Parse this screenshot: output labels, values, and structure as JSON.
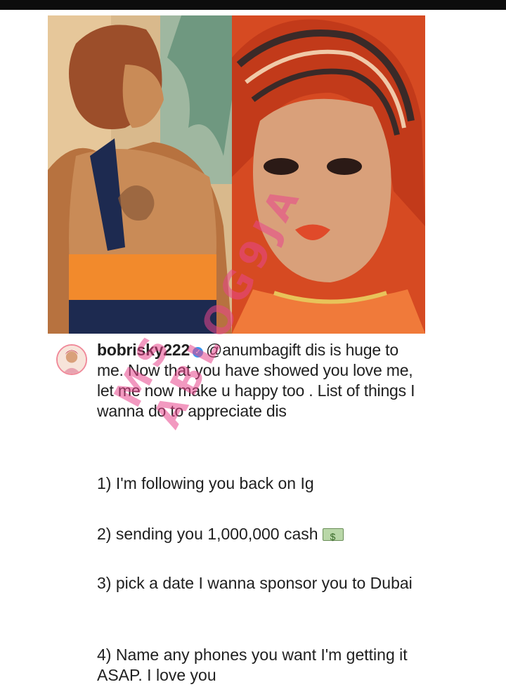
{
  "post": {
    "username": "bobrisky222",
    "mention": "@anumbagift",
    "caption": " dis is huge to me. Now that you have showed you love me, let me now make u happy too .  List of things I wanna do to appreciate dis",
    "list": [
      "1) I'm following you back on Ig",
      "2) sending you 1,000,000 cash",
      "3) pick a date I wanna sponsor you to Dubai",
      "4) Name any phones you want I'm getting it ASAP. I love you"
    ],
    "cash_icon": "dollar-banknote-icon",
    "verified_icon": "verified-badge-icon"
  },
  "watermark": "MS ABLOG9JA",
  "colors": {
    "top_bar": "#0d0d0d",
    "text": "#1f1f1f",
    "verified": "#3897f0",
    "watermark": "#e8468c"
  }
}
